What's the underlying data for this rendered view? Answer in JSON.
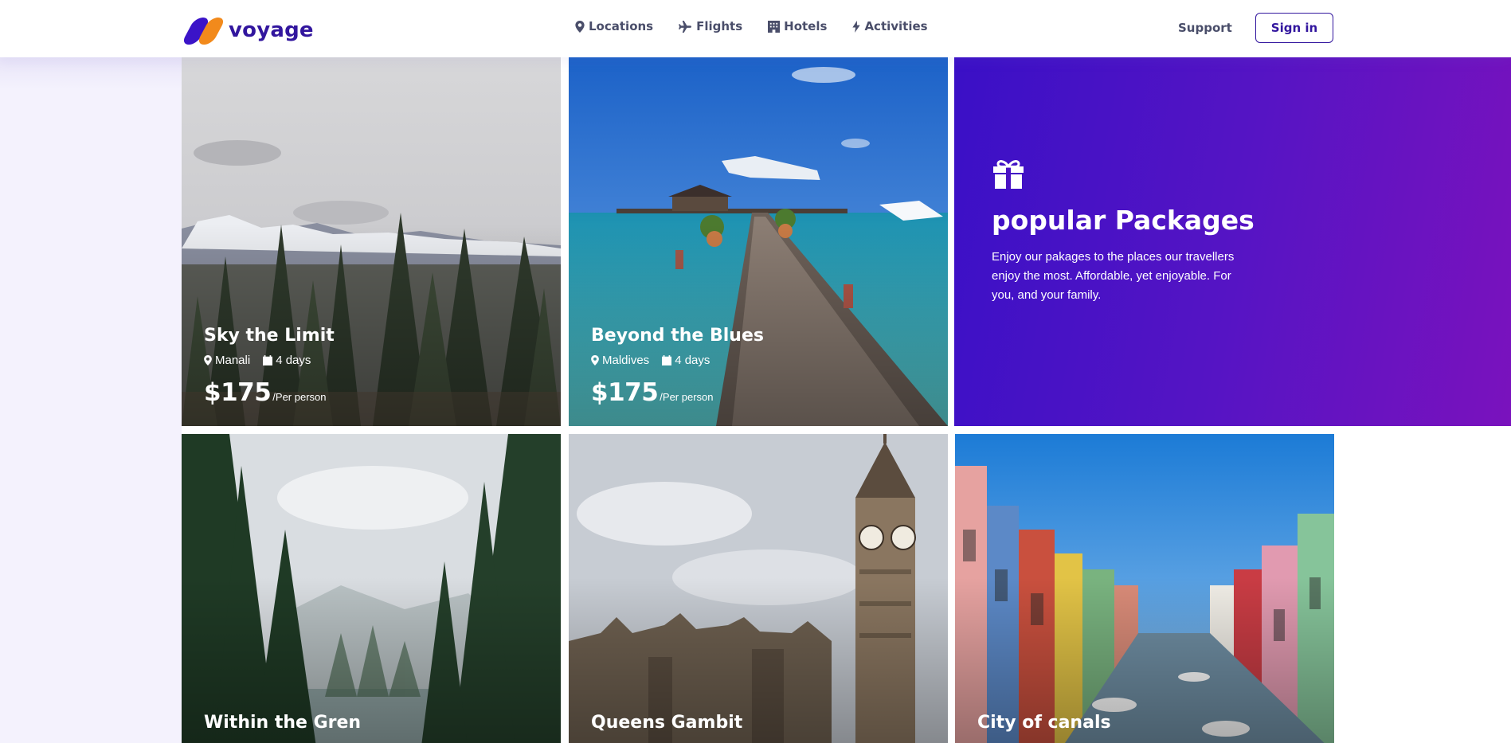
{
  "brand": {
    "name": "voyage",
    "colors": {
      "primary": "#32169e",
      "accent": "#f28a1c",
      "promo_start": "#3a10c6",
      "promo_end": "#7a12bd"
    }
  },
  "nav": {
    "items": [
      {
        "label": "Locations",
        "icon": "map-pin-icon"
      },
      {
        "label": "Flights",
        "icon": "plane-icon"
      },
      {
        "label": "Hotels",
        "icon": "building-icon"
      },
      {
        "label": "Activities",
        "icon": "bolt-icon"
      }
    ],
    "support": "Support",
    "signin": "Sign in"
  },
  "promo": {
    "icon": "gift-icon",
    "title": "popular Packages",
    "text": "Enjoy our pakages to the places our travellers enjoy the most. Affordable, yet enjoyable. For you, and your family."
  },
  "packages": [
    {
      "title": "Sky the Limit",
      "location": "Manali",
      "duration": "4 days",
      "price": "$175",
      "unit": "/Per person"
    },
    {
      "title": "Beyond the Blues",
      "location": "Maldives",
      "duration": "4 days",
      "price": "$175",
      "unit": "/Per person"
    },
    {
      "title": "Within the Gren",
      "location": "",
      "duration": "",
      "price": "",
      "unit": ""
    },
    {
      "title": "Queens Gambit",
      "location": "",
      "duration": "",
      "price": "",
      "unit": ""
    },
    {
      "title": "City of canals",
      "location": "",
      "duration": "",
      "price": "",
      "unit": ""
    }
  ]
}
